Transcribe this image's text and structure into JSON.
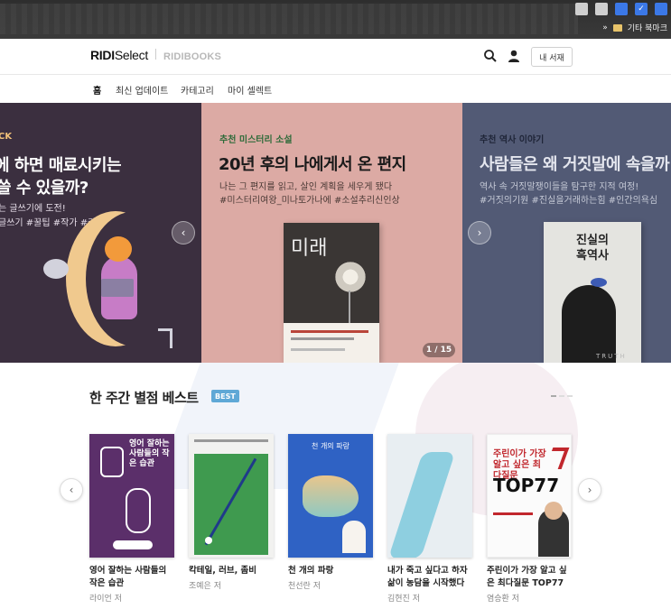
{
  "browser": {
    "bookmark_label": "기타 북마크",
    "overflow_label": "»"
  },
  "header": {
    "logo_main": "RIDI",
    "logo_main_suffix": "Select",
    "logo_sub": "RIDIBOOKS",
    "library_button": "내 서재"
  },
  "nav": {
    "items": [
      {
        "label": "홈"
      },
      {
        "label": "최신 업데이트"
      },
      {
        "label": "카테고리"
      },
      {
        "label": "마이 셀렉트"
      }
    ]
  },
  "banner": {
    "slides": [
      {
        "tag": "CK",
        "title_line1": "에 하면 매료시키는",
        "title_line2": "쓸 수 있을까?",
        "desc_line1": "는 글쓰기에 도전!",
        "desc_line2": "글쓰기 #꿀팁 #작가 #카피"
      },
      {
        "tag": "추천 미스터리 소설",
        "title": "20년 후의 나에게서 온 편지",
        "desc_line1": "나는 그 편지를 읽고, 살인 계획을 세우게 됐다",
        "desc_line2": "#미스터리여왕_미나토가나에 #소설추리신인상",
        "book_title": "미래"
      },
      {
        "tag": "추천 역사 이야기",
        "title": "사람들은 왜 거짓말에 속을까",
        "desc_line1": "역사 속 거짓말쟁이들을 탐구한 지적 여정!",
        "desc_line2": "#거짓의기원 #진실을거래하는힘 #인간의욕심",
        "book_title_line1": "진실의",
        "book_title_line2": "흑역사",
        "book_bottom": "TRUTH"
      }
    ],
    "page_indicator": "1 / 15"
  },
  "best": {
    "section_title": "한 주간 별점 베스트",
    "badge": "BEST",
    "books": [
      {
        "title": "영어 잘하는 사람들의 작은 습관",
        "author": "라이언 저",
        "cover_text": "영어 잘하는 사람들의 작은 습관"
      },
      {
        "title": "칵테일, 러브, 좀비",
        "author": "조예은 저"
      },
      {
        "title": "천 개의 파랑",
        "author": "천선란 저",
        "cover_text": "천 개의 파랑"
      },
      {
        "title": "내가 죽고 싶다고 하자 삶이 농담을 시작했다",
        "author": "김현진 저"
      },
      {
        "title": "주린이가 가장 알고 싶은 최다질문 TOP77",
        "author": "염승환 저",
        "cover_text_1": "주린이가 가장 알고 싶은 최다질문",
        "cover_text_2": "TOP77"
      }
    ]
  },
  "colors": {
    "slide_left_bg": "#3b2f3f",
    "slide_mid_bg": "#dcaaa4",
    "slide_right_bg": "#525a75",
    "badge_bg": "#5fa8d6"
  },
  "icons": {
    "search": "search-icon",
    "user": "user-icon",
    "prev": "chevron-left-icon",
    "next": "chevron-right-icon"
  }
}
